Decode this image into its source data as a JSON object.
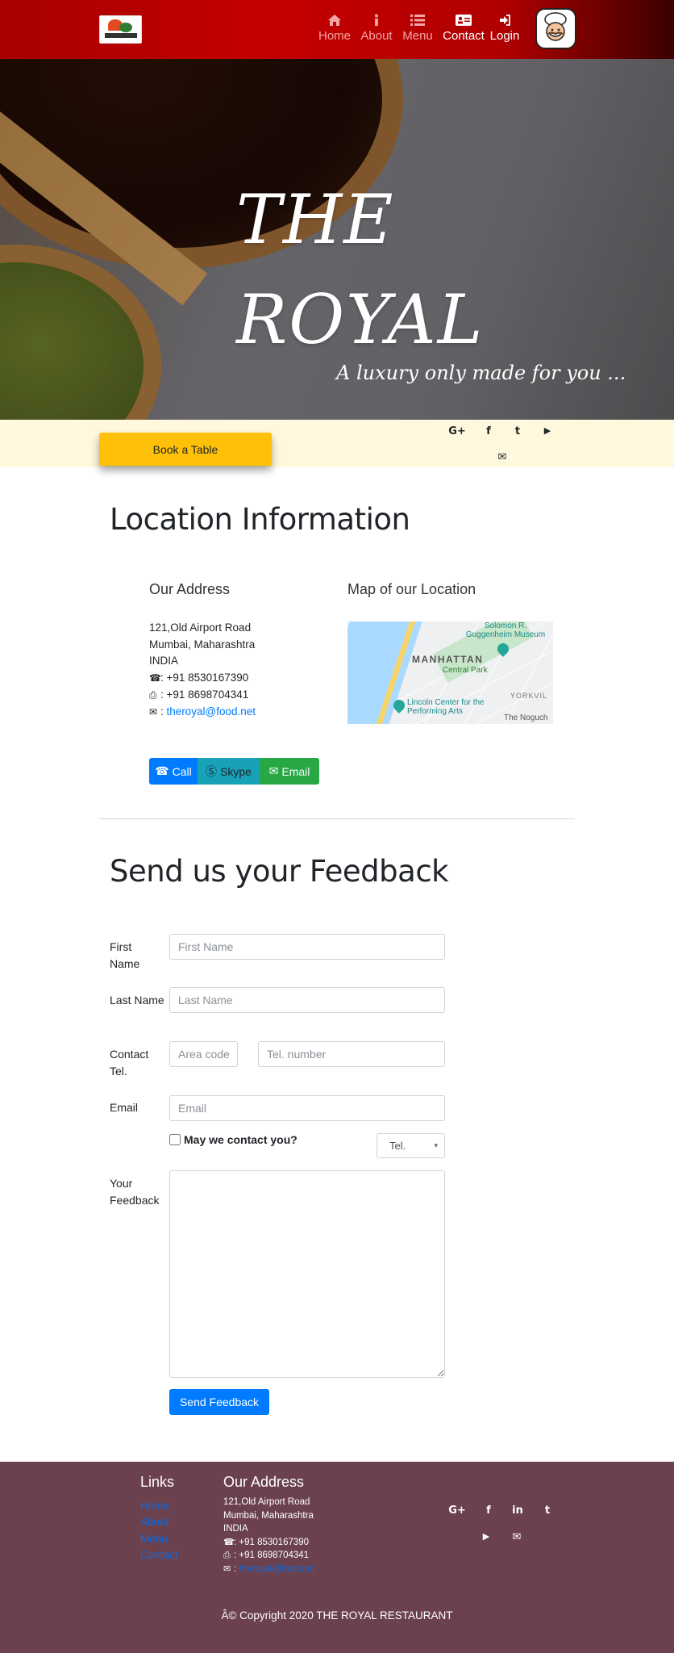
{
  "nav": {
    "brand_logo_icon": "restaurant-logo",
    "items": [
      {
        "icon": "home-icon",
        "label": "Home"
      },
      {
        "icon": "info-icon",
        "label": "About"
      },
      {
        "icon": "list-icon",
        "label": "Menu"
      },
      {
        "icon": "address-card-icon",
        "label": "Contact",
        "active": true
      },
      {
        "icon": "sign-in-icon",
        "label": "Login"
      }
    ],
    "chef_icon": "chef-logo"
  },
  "hero": {
    "title_line1": "THE",
    "title_line2": "ROYAL",
    "tagline": "A luxury only made for you ..."
  },
  "book_bar": {
    "button_label": "Book a Table",
    "button_color": "#ffc107",
    "social_icons": [
      "google-plus-icon",
      "facebook-icon",
      "twitter-icon",
      "youtube-icon",
      "envelope-icon"
    ],
    "social_glyphs": [
      "G+",
      "f",
      "t",
      "▶",
      "✉"
    ]
  },
  "location": {
    "title": "Location Information",
    "address_heading": "Our Address",
    "map_heading": "Map of our Location",
    "address_lines": [
      "121,Old Airport Road",
      "Mumbai, Maharashtra",
      "INDIA"
    ],
    "phone": ": +91 8530167390",
    "fax": ": +91 8698704341",
    "email_prefix": ": ",
    "email": "theroyal@food.net",
    "map_labels": {
      "guggenheim": "Solomon R. Guggenheim Museum",
      "manhattan": "MANHATTAN",
      "central_park": "Central Park",
      "lincoln": "Lincoln Center for the Performing Arts",
      "yorkville": "YORKVIL",
      "noguchi": "The Noguch"
    },
    "buttons": {
      "call": "Call",
      "skype": "Skype",
      "email": "Email"
    }
  },
  "feedback": {
    "title": "Send us your Feedback",
    "first_name_label": "First Name",
    "first_name_placeholder": "First Name",
    "last_name_label": "Last Name",
    "last_name_placeholder": "Last Name",
    "contact_label": "Contact Tel.",
    "area_code_placeholder": "Area code",
    "tel_placeholder": "Tel. number",
    "email_label": "Email",
    "email_placeholder": "Email",
    "may_contact_label": "May we contact you?",
    "contact_method_selected": "Tel.",
    "feedback_label": "Your Feedback",
    "send_label": "Send Feedback"
  },
  "footer": {
    "links_heading": "Links",
    "links": [
      "Home",
      "About",
      "Menu",
      "Contact"
    ],
    "address_heading": "Our Address",
    "address_lines": [
      "121,Old Airport Road",
      "Mumbai, Maharashtra",
      "INDIA"
    ],
    "phone": ": +91 8530167390",
    "fax": ": +91 8698704341",
    "email_prefix": ": ",
    "email": "theroyal@food.net",
    "social_icons": [
      "google-plus-icon",
      "facebook-icon",
      "linkedin-icon",
      "twitter-icon",
      "youtube-icon",
      "envelope-icon"
    ],
    "social_glyphs": [
      "G+",
      "f",
      "in",
      "t",
      "▶",
      "✉"
    ],
    "copyright": "Â© Copyright 2020 THE ROYAL RESTAURANT",
    "background_color": "#6b414e"
  }
}
